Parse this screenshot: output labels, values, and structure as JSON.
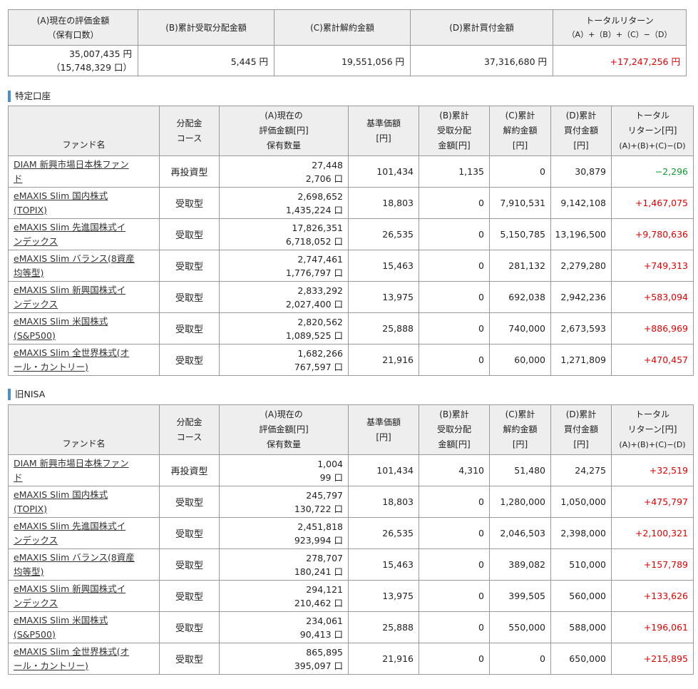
{
  "summary": {
    "headers": {
      "a_line1": "(A)現在の評価金額",
      "a_line2": "（保有口数）",
      "b": "(B)累計受取分配金額",
      "c": "(C)累計解約金額",
      "d": "(D)累計買付金額",
      "total_line1": "トータルリターン",
      "total_line2": "（A）+（B）+（C）−（D）"
    },
    "values": {
      "a_amount": "35,007,435 円",
      "a_units": "（15,748,329 口）",
      "b": "5,445 円",
      "c": "19,551,056 円",
      "d": "37,316,680 円",
      "total": "+17,247,256 円"
    }
  },
  "columns": {
    "fund": "ファンド名",
    "course_line1": "分配金",
    "course_line2": "コース",
    "a_line1": "(A)現在の",
    "a_line2": "評価金額[円]",
    "a_line3": "保有数量",
    "nav_line1": "基準価額",
    "nav_line2": "[円]",
    "b_line1": "(B)累計",
    "b_line2": "受取分配",
    "b_line3": "金額[円]",
    "c_line1": "(C)累計",
    "c_line2": "解約金額",
    "c_line3": "[円]",
    "d_line1": "(D)累計",
    "d_line2": "買付金額",
    "d_line3": "[円]",
    "total_line1": "トータル",
    "total_line2": "リターン[円]",
    "total_line3": "(A)+(B)+(C)−(D)"
  },
  "sections": [
    {
      "title": "特定口座",
      "rows": [
        {
          "fund_line1": "DIAM 新興市場日本株ファン",
          "fund_line2": "ド",
          "course": "再投資型",
          "amount": "27,448",
          "units": "2,706 口",
          "nav": "101,434",
          "b": "1,135",
          "c": "0",
          "d": "30,879",
          "total": "−2,296"
        },
        {
          "fund_line1": "eMAXIS Slim 国内株式",
          "fund_line2": "(TOPIX)",
          "course": "受取型",
          "amount": "2,698,652",
          "units": "1,435,224 口",
          "nav": "18,803",
          "b": "0",
          "c": "7,910,531",
          "d": "9,142,108",
          "total": "+1,467,075"
        },
        {
          "fund_line1": "eMAXIS Slim 先進国株式イ",
          "fund_line2": "ンデックス",
          "course": "受取型",
          "amount": "17,826,351",
          "units": "6,718,052 口",
          "nav": "26,535",
          "b": "0",
          "c": "5,150,785",
          "d": "13,196,500",
          "total": "+9,780,636"
        },
        {
          "fund_line1": "eMAXIS Slim バランス(8資産",
          "fund_line2": "均等型)",
          "course": "受取型",
          "amount": "2,747,461",
          "units": "1,776,797 口",
          "nav": "15,463",
          "b": "0",
          "c": "281,132",
          "d": "2,279,280",
          "total": "+749,313"
        },
        {
          "fund_line1": "eMAXIS Slim 新興国株式イ",
          "fund_line2": "ンデックス",
          "course": "受取型",
          "amount": "2,833,292",
          "units": "2,027,400 口",
          "nav": "13,975",
          "b": "0",
          "c": "692,038",
          "d": "2,942,236",
          "total": "+583,094"
        },
        {
          "fund_line1": "eMAXIS Slim 米国株式",
          "fund_line2": "(S&P500)",
          "course": "受取型",
          "amount": "2,820,562",
          "units": "1,089,525 口",
          "nav": "25,888",
          "b": "0",
          "c": "740,000",
          "d": "2,673,593",
          "total": "+886,969"
        },
        {
          "fund_line1": "eMAXIS Slim 全世界株式(オ",
          "fund_line2": "ール・カントリー)",
          "course": "受取型",
          "amount": "1,682,266",
          "units": "767,597 口",
          "nav": "21,916",
          "b": "0",
          "c": "60,000",
          "d": "1,271,809",
          "total": "+470,457"
        }
      ]
    },
    {
      "title": "旧NISA",
      "rows": [
        {
          "fund_line1": "DIAM 新興市場日本株ファン",
          "fund_line2": "ド",
          "course": "再投資型",
          "amount": "1,004",
          "units": "99 口",
          "nav": "101,434",
          "b": "4,310",
          "c": "51,480",
          "d": "24,275",
          "total": "+32,519"
        },
        {
          "fund_line1": "eMAXIS Slim 国内株式",
          "fund_line2": "(TOPIX)",
          "course": "受取型",
          "amount": "245,797",
          "units": "130,722 口",
          "nav": "18,803",
          "b": "0",
          "c": "1,280,000",
          "d": "1,050,000",
          "total": "+475,797"
        },
        {
          "fund_line1": "eMAXIS Slim 先進国株式イ",
          "fund_line2": "ンデックス",
          "course": "受取型",
          "amount": "2,451,818",
          "units": "923,994 口",
          "nav": "26,535",
          "b": "0",
          "c": "2,046,503",
          "d": "2,398,000",
          "total": "+2,100,321"
        },
        {
          "fund_line1": "eMAXIS Slim バランス(8資産",
          "fund_line2": "均等型)",
          "course": "受取型",
          "amount": "278,707",
          "units": "180,241 口",
          "nav": "15,463",
          "b": "0",
          "c": "389,082",
          "d": "510,000",
          "total": "+157,789"
        },
        {
          "fund_line1": "eMAXIS Slim 新興国株式イ",
          "fund_line2": "ンデックス",
          "course": "受取型",
          "amount": "294,121",
          "units": "210,462 口",
          "nav": "13,975",
          "b": "0",
          "c": "399,505",
          "d": "560,000",
          "total": "+133,626"
        },
        {
          "fund_line1": "eMAXIS Slim 米国株式",
          "fund_line2": "(S&P500)",
          "course": "受取型",
          "amount": "234,061",
          "units": "90,413 口",
          "nav": "25,888",
          "b": "0",
          "c": "550,000",
          "d": "588,000",
          "total": "+196,061"
        },
        {
          "fund_line1": "eMAXIS Slim 全世界株式(オ",
          "fund_line2": "ール・カントリー)",
          "course": "受取型",
          "amount": "865,895",
          "units": "395,097 口",
          "nav": "21,916",
          "b": "0",
          "c": "0",
          "d": "650,000",
          "total": "+215,895"
        }
      ]
    }
  ],
  "colors": {
    "positive": "#e00000",
    "negative": "#0b9a2c",
    "section_marker": "#4a8fd4",
    "header_bg": "#eeeeee"
  }
}
